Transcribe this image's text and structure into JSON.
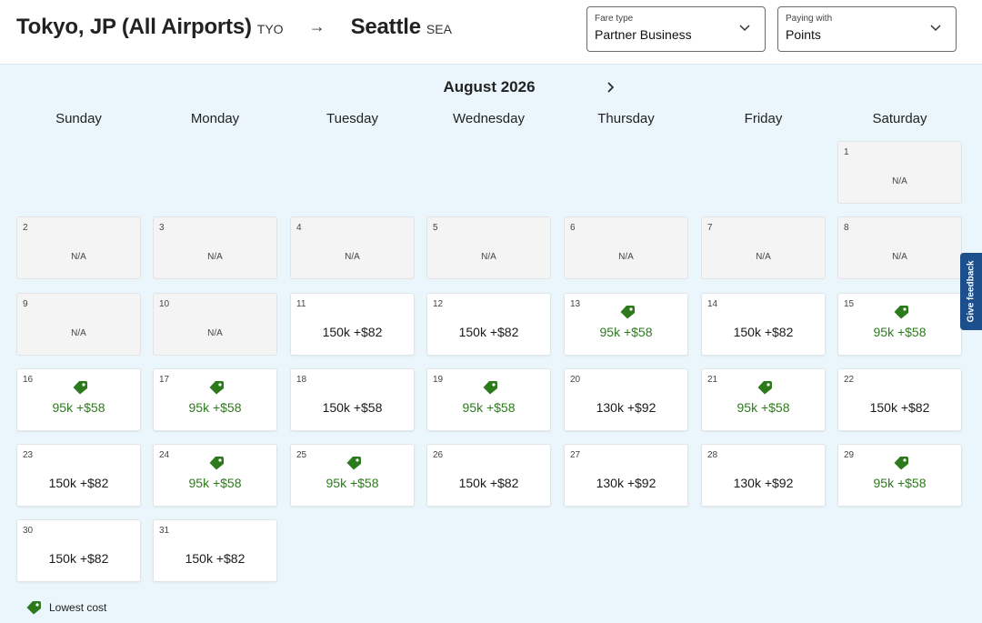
{
  "route": {
    "origin_city": "Tokyo, JP (All Airports)",
    "origin_code": "TYO",
    "arrow": "→",
    "dest_city": "Seattle",
    "dest_code": "SEA"
  },
  "fare_type": {
    "label": "Fare type",
    "value": "Partner Business"
  },
  "paying_with": {
    "label": "Paying with",
    "value": "Points"
  },
  "calendar": {
    "month": "August 2026",
    "weekdays": [
      "Sunday",
      "Monday",
      "Tuesday",
      "Wednesday",
      "Thursday",
      "Friday",
      "Saturday"
    ],
    "days": [
      {
        "day": "1",
        "price": "N/A",
        "lowest": false
      },
      {
        "day": "2",
        "price": "N/A",
        "lowest": false
      },
      {
        "day": "3",
        "price": "N/A",
        "lowest": false
      },
      {
        "day": "4",
        "price": "N/A",
        "lowest": false
      },
      {
        "day": "5",
        "price": "N/A",
        "lowest": false
      },
      {
        "day": "6",
        "price": "N/A",
        "lowest": false
      },
      {
        "day": "7",
        "price": "N/A",
        "lowest": false
      },
      {
        "day": "8",
        "price": "N/A",
        "lowest": false
      },
      {
        "day": "9",
        "price": "N/A",
        "lowest": false
      },
      {
        "day": "10",
        "price": "N/A",
        "lowest": false
      },
      {
        "day": "11",
        "price": "150k +$82",
        "lowest": false
      },
      {
        "day": "12",
        "price": "150k +$82",
        "lowest": false
      },
      {
        "day": "13",
        "price": "95k +$58",
        "lowest": true
      },
      {
        "day": "14",
        "price": "150k +$82",
        "lowest": false
      },
      {
        "day": "15",
        "price": "95k +$58",
        "lowest": true
      },
      {
        "day": "16",
        "price": "95k +$58",
        "lowest": true
      },
      {
        "day": "17",
        "price": "95k +$58",
        "lowest": true
      },
      {
        "day": "18",
        "price": "150k +$58",
        "lowest": false
      },
      {
        "day": "19",
        "price": "95k +$58",
        "lowest": true
      },
      {
        "day": "20",
        "price": "130k +$92",
        "lowest": false
      },
      {
        "day": "21",
        "price": "95k +$58",
        "lowest": true
      },
      {
        "day": "22",
        "price": "150k +$82",
        "lowest": false
      },
      {
        "day": "23",
        "price": "150k +$82",
        "lowest": false
      },
      {
        "day": "24",
        "price": "95k +$58",
        "lowest": true
      },
      {
        "day": "25",
        "price": "95k +$58",
        "lowest": true
      },
      {
        "day": "26",
        "price": "150k +$82",
        "lowest": false
      },
      {
        "day": "27",
        "price": "130k +$92",
        "lowest": false
      },
      {
        "day": "28",
        "price": "130k +$92",
        "lowest": false
      },
      {
        "day": "29",
        "price": "95k +$58",
        "lowest": true
      },
      {
        "day": "30",
        "price": "150k +$82",
        "lowest": false
      },
      {
        "day": "31",
        "price": "150k +$82",
        "lowest": false
      }
    ]
  },
  "legend": {
    "label": "Lowest cost",
    "icon": "price-tag-icon"
  },
  "feedback": {
    "label": "Give feedback"
  },
  "colors": {
    "lowest": "#2d7a1d",
    "feedback_bg": "#1d4f8c",
    "background": "#eaf6fb"
  }
}
